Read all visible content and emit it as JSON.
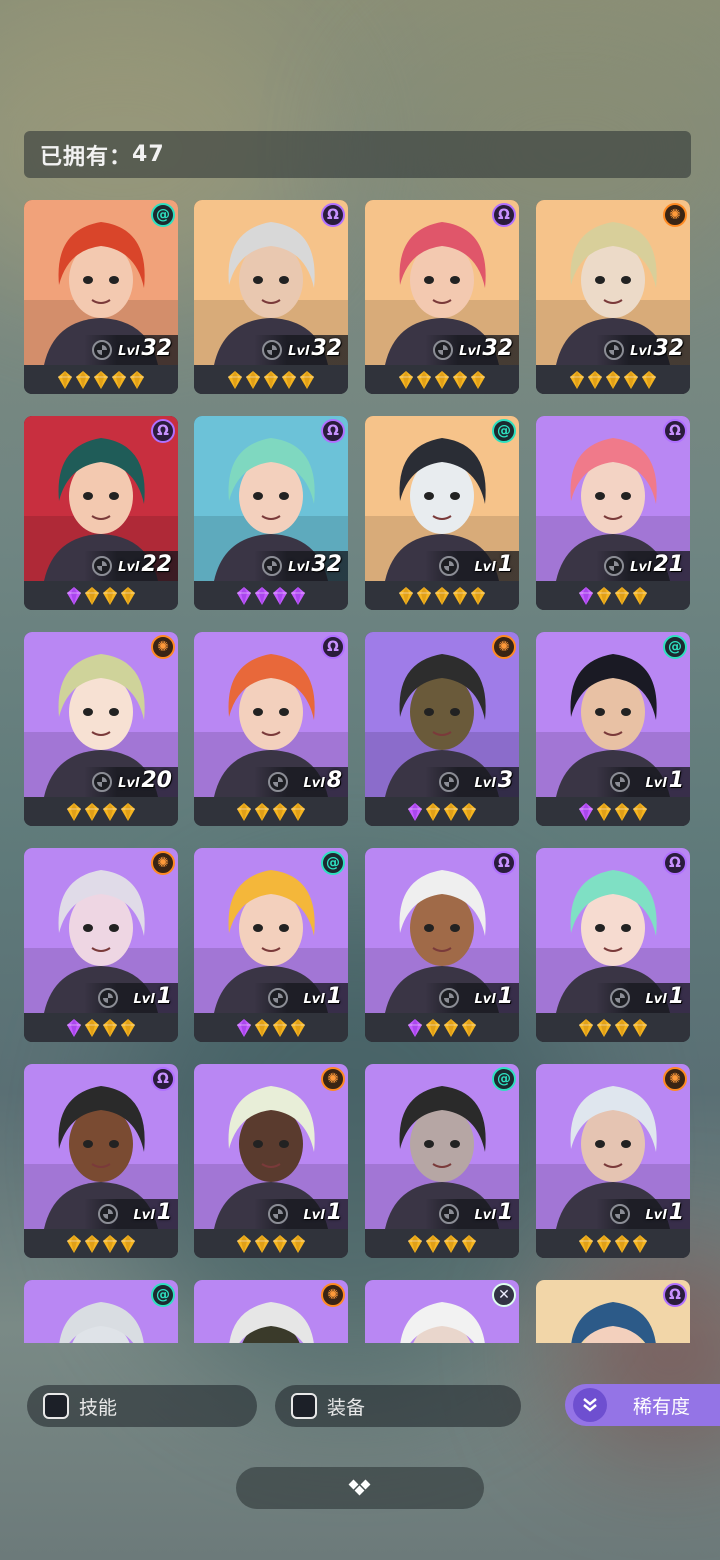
{
  "header": {
    "owned_label": "已拥有：",
    "owned_count": "47"
  },
  "colors": {
    "gold_gem": "#f5b520",
    "purple_gem": "#c45cff",
    "rarity_accent": "#9474e6",
    "class_teal": "#2ee0c0",
    "class_purple": "#b070ff",
    "class_orange": "#ff8a22"
  },
  "heroes": [
    {
      "level": "32",
      "lvl_label": "Lvl",
      "class_icon": "teal-swirl-icon",
      "gems": [
        "gold",
        "gold",
        "gold",
        "gold",
        "gold"
      ],
      "bg": "#f1a27a",
      "hair": "#d9452a",
      "skin": "#f3c9b0"
    },
    {
      "level": "32",
      "lvl_label": "Lvl",
      "class_icon": "purple-omega-icon",
      "gems": [
        "gold",
        "gold",
        "gold",
        "gold",
        "gold"
      ],
      "bg": "#f6c38a",
      "hair": "#d8d8d8",
      "skin": "#e9c8b0"
    },
    {
      "level": "32",
      "lvl_label": "Lvl",
      "class_icon": "purple-omega-icon",
      "gems": [
        "gold",
        "gold",
        "gold",
        "gold",
        "gold"
      ],
      "bg": "#f6c38a",
      "hair": "#e0566a",
      "skin": "#f3c9b0"
    },
    {
      "level": "32",
      "lvl_label": "Lvl",
      "class_icon": "orange-gear-icon",
      "gems": [
        "gold",
        "gold",
        "gold",
        "gold",
        "gold"
      ],
      "bg": "#f6c38a",
      "hair": "#d8cf9a",
      "skin": "#ecdac8"
    },
    {
      "level": "22",
      "lvl_label": "Lvl",
      "class_icon": "purple-omega-icon",
      "gems": [
        "purple",
        "gold",
        "gold",
        "gold"
      ],
      "bg": "#c82f3f",
      "hair": "#1f5c58",
      "skin": "#f3c9b0"
    },
    {
      "level": "32",
      "lvl_label": "Lvl",
      "class_icon": "purple-omega-icon",
      "gems": [
        "purple",
        "purple",
        "purple",
        "purple"
      ],
      "bg": "#6cc2d8",
      "hair": "#7fd8c0",
      "skin": "#f3d0bd"
    },
    {
      "level": "1",
      "lvl_label": "Lvl",
      "class_icon": "teal-swirl-icon",
      "gems": [
        "gold",
        "gold",
        "gold",
        "gold",
        "gold"
      ],
      "bg": "#f6c38a",
      "hair": "#2a2d35",
      "skin": "#e8ecef"
    },
    {
      "level": "21",
      "lvl_label": "Lvl",
      "class_icon": "purple-omega-icon",
      "gems": [
        "purple",
        "gold",
        "gold",
        "gold"
      ],
      "bg": "#b987f3",
      "hair": "#f07a8a",
      "skin": "#f3d3c4"
    },
    {
      "level": "20",
      "lvl_label": "Lvl",
      "class_icon": "orange-gear-icon",
      "gems": [
        "gold",
        "gold",
        "gold",
        "gold"
      ],
      "bg": "#b987f3",
      "hair": "#cfd39a",
      "skin": "#f7e1d3"
    },
    {
      "level": "8",
      "lvl_label": "Lvl",
      "class_icon": "purple-omega-icon",
      "gems": [
        "gold",
        "gold",
        "gold",
        "gold"
      ],
      "bg": "#b987f3",
      "hair": "#e8683a",
      "skin": "#f3d0bd"
    },
    {
      "level": "3",
      "lvl_label": "Lvl",
      "class_icon": "orange-gear-icon",
      "gems": [
        "purple",
        "gold",
        "gold",
        "gold"
      ],
      "bg": "#9f7ce8",
      "hair": "#2d2d2d",
      "skin": "#6a5a3a"
    },
    {
      "level": "1",
      "lvl_label": "Lvl",
      "class_icon": "teal-swirl-icon",
      "gems": [
        "purple",
        "gold",
        "gold",
        "gold"
      ],
      "bg": "#b987f3",
      "hair": "#1a1a24",
      "skin": "#e8c1a4"
    },
    {
      "level": "1",
      "lvl_label": "Lvl",
      "class_icon": "orange-gear-icon",
      "gems": [
        "purple",
        "gold",
        "gold",
        "gold"
      ],
      "bg": "#b987f3",
      "hair": "#e0dbe8",
      "skin": "#eed6e3"
    },
    {
      "level": "1",
      "lvl_label": "Lvl",
      "class_icon": "teal-swirl-icon",
      "gems": [
        "purple",
        "gold",
        "gold",
        "gold"
      ],
      "bg": "#b987f3",
      "hair": "#f4b73a",
      "skin": "#f3d0bd"
    },
    {
      "level": "1",
      "lvl_label": "Lvl",
      "class_icon": "purple-omega-icon",
      "gems": [
        "purple",
        "gold",
        "gold",
        "gold"
      ],
      "bg": "#b987f3",
      "hair": "#efefef",
      "skin": "#a06a48"
    },
    {
      "level": "1",
      "lvl_label": "Lvl",
      "class_icon": "purple-omega-icon",
      "gems": [
        "gold",
        "gold",
        "gold",
        "gold"
      ],
      "bg": "#b987f3",
      "hair": "#7fe0c4",
      "skin": "#f6dbd0"
    },
    {
      "level": "1",
      "lvl_label": "Lvl",
      "class_icon": "purple-omega-icon",
      "gems": [
        "gold",
        "gold",
        "gold",
        "gold"
      ],
      "bg": "#b987f3",
      "hair": "#2a2a2a",
      "skin": "#7a4b32"
    },
    {
      "level": "1",
      "lvl_label": "Lvl",
      "class_icon": "orange-gear-icon",
      "gems": [
        "gold",
        "gold",
        "gold",
        "gold"
      ],
      "bg": "#b987f3",
      "hair": "#e8eed8",
      "skin": "#5a3b2e"
    },
    {
      "level": "1",
      "lvl_label": "Lvl",
      "class_icon": "teal-swirl-icon",
      "gems": [
        "gold",
        "gold",
        "gold",
        "gold"
      ],
      "bg": "#b987f3",
      "hair": "#2a2a2a",
      "skin": "#b6a6a4"
    },
    {
      "level": "1",
      "lvl_label": "Lvl",
      "class_icon": "orange-gear-icon",
      "gems": [
        "gold",
        "gold",
        "gold",
        "gold"
      ],
      "bg": "#b987f3",
      "hair": "#dfe6ee",
      "skin": "#e5c4b2"
    },
    {
      "level": "",
      "lvl_label": "",
      "class_icon": "teal-swirl-icon",
      "gems": [],
      "bg": "#b987f3",
      "hair": "#d9dde2",
      "skin": "#dfe3e8"
    },
    {
      "level": "",
      "lvl_label": "",
      "class_icon": "orange-gear-icon",
      "gems": [],
      "bg": "#b987f3",
      "hair": "#e6e6e6",
      "skin": "#3a3a2a"
    },
    {
      "level": "",
      "lvl_label": "",
      "class_icon": "white-x-icon",
      "gems": [],
      "bg": "#b987f3",
      "hair": "#f2f2f2",
      "skin": "#e9d6cc"
    },
    {
      "level": "",
      "lvl_label": "",
      "class_icon": "purple-omega-icon",
      "gems": [],
      "bg": "#f2d6a8",
      "hair": "#2c5a88",
      "skin": "#f3d0bd"
    }
  ],
  "filters": {
    "skill_label": "技能",
    "equipment_label": "装备",
    "rarity_label": "稀有度",
    "rarity_icon": "double-chevron-down-icon"
  },
  "bottom_pill": {
    "icon": "diamond-cluster-icon"
  }
}
